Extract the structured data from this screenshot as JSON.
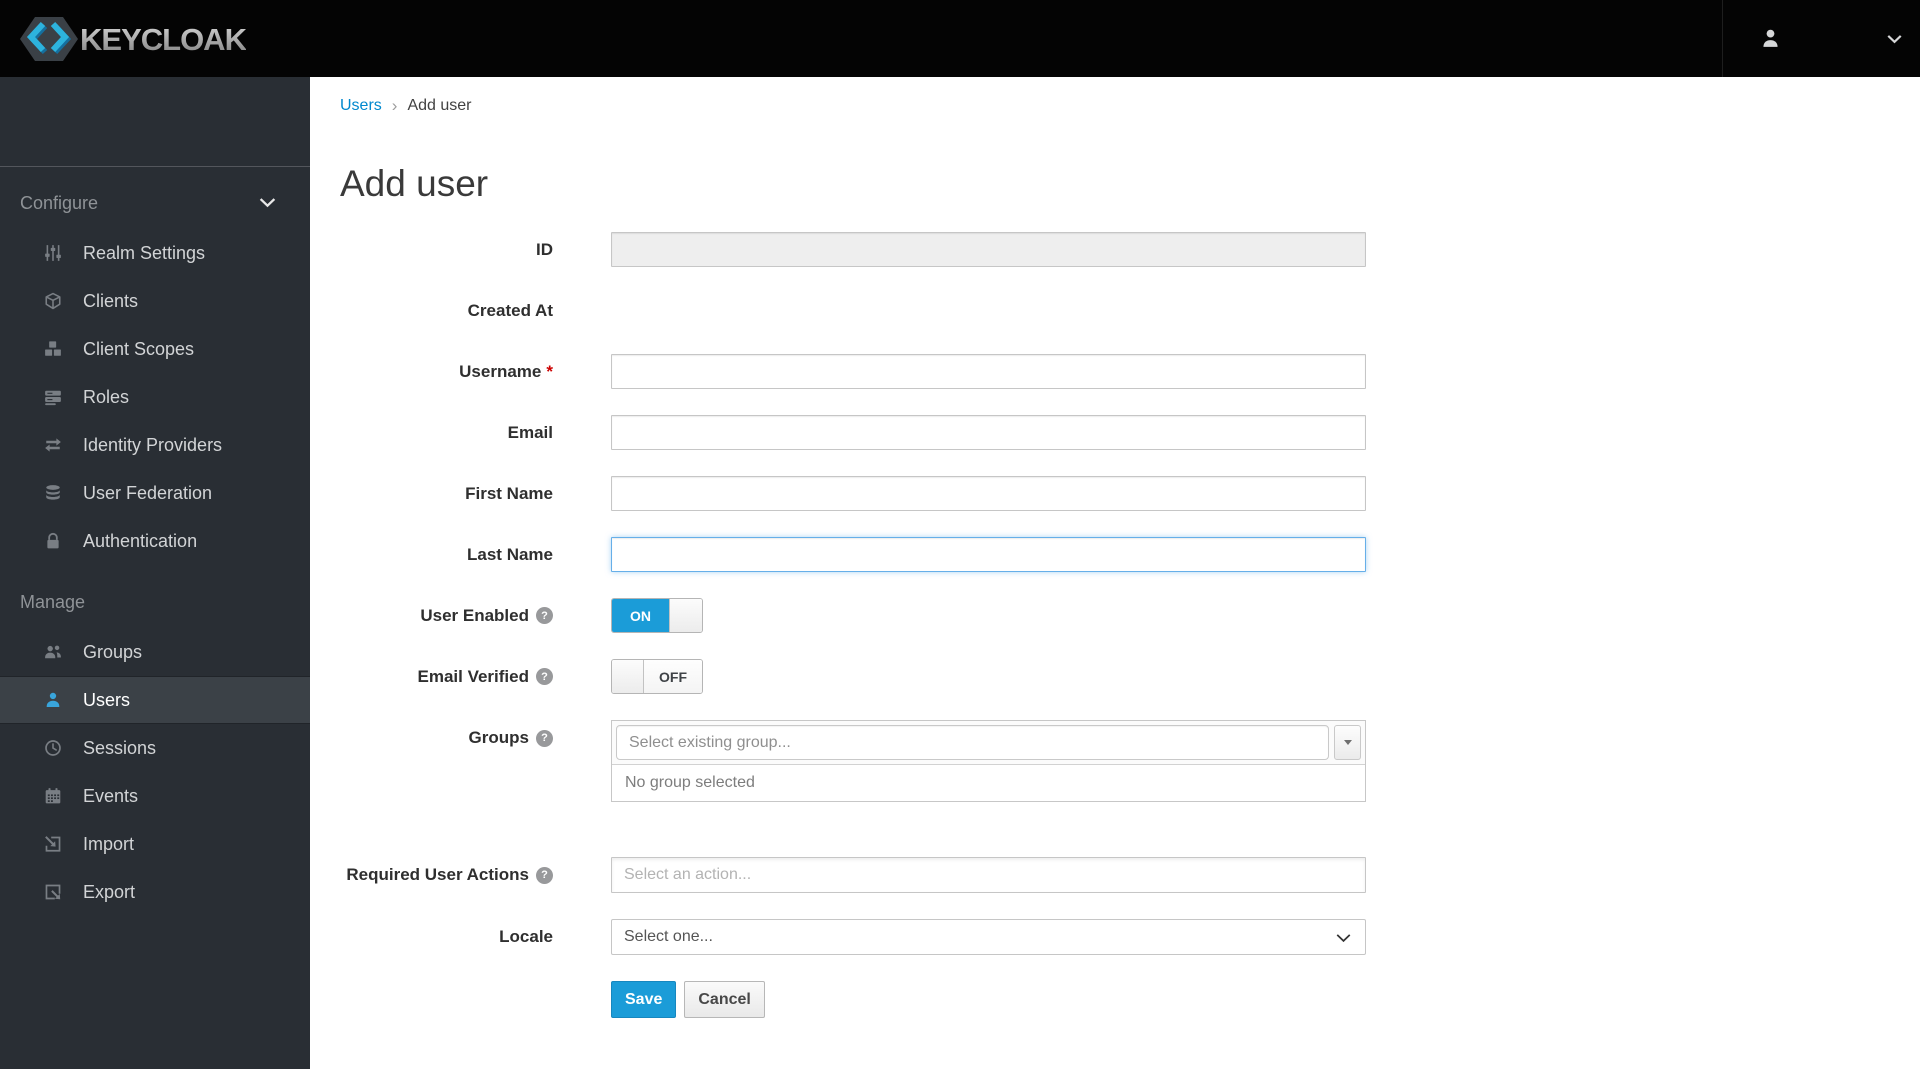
{
  "navbar": {
    "brand": "KEYCLOAK"
  },
  "breadcrumb": {
    "items": [
      {
        "label": "Users"
      },
      {
        "label": "Add user"
      }
    ],
    "separator": "›"
  },
  "page": {
    "title": "Add user"
  },
  "sidebar": {
    "sections": [
      {
        "label": "Configure",
        "items": [
          {
            "label": "Realm Settings",
            "icon": "sliders-icon"
          },
          {
            "label": "Clients",
            "icon": "cube-icon"
          },
          {
            "label": "Client Scopes",
            "icon": "cubes-icon"
          },
          {
            "label": "Roles",
            "icon": "server-list-icon"
          },
          {
            "label": "Identity Providers",
            "icon": "exchange-icon"
          },
          {
            "label": "User Federation",
            "icon": "database-icon"
          },
          {
            "label": "Authentication",
            "icon": "lock-icon"
          }
        ]
      },
      {
        "label": "Manage",
        "items": [
          {
            "label": "Groups",
            "icon": "users-icon"
          },
          {
            "label": "Users",
            "icon": "user-icon",
            "active": true
          },
          {
            "label": "Sessions",
            "icon": "clock-icon"
          },
          {
            "label": "Events",
            "icon": "calendar-icon"
          },
          {
            "label": "Import",
            "icon": "import-icon"
          },
          {
            "label": "Export",
            "icon": "export-icon"
          }
        ]
      }
    ]
  },
  "form": {
    "id": {
      "label": "ID",
      "value": "",
      "disabled": true
    },
    "created_at": {
      "label": "Created At",
      "value": ""
    },
    "username": {
      "label": "Username",
      "required_marker": "*",
      "value": ""
    },
    "email": {
      "label": "Email",
      "value": ""
    },
    "first_name": {
      "label": "First Name",
      "value": ""
    },
    "last_name": {
      "label": "Last Name",
      "value": "",
      "focused": true
    },
    "user_enabled": {
      "label": "User Enabled",
      "state": "ON"
    },
    "email_verified": {
      "label": "Email Verified",
      "state": "OFF"
    },
    "groups": {
      "label": "Groups",
      "placeholder": "Select existing group...",
      "empty_text": "No group selected"
    },
    "required_user_actions": {
      "label": "Required User Actions",
      "placeholder": "Select an action..."
    },
    "locale": {
      "label": "Locale",
      "value": "Select one..."
    },
    "buttons": {
      "save": "Save",
      "cancel": "Cancel"
    }
  },
  "colors": {
    "link_blue": "#0088ce",
    "primary_blue": "#1b9cd8",
    "active_icon_blue": "#39a5dc",
    "required_red": "#cc0000",
    "sidebar_bg": "#292e34",
    "navbar_bg": "#040404"
  }
}
